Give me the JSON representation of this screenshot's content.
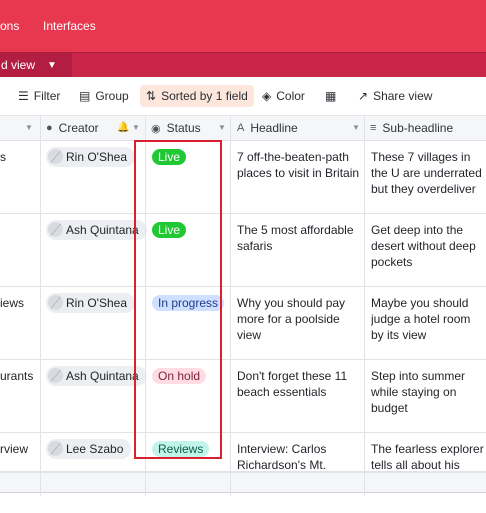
{
  "topbar": {
    "tabs": [
      "ons",
      "Interfaces"
    ],
    "view_name": "d view",
    "colors": {
      "top": "#e8384f",
      "sub": "#c9264a"
    }
  },
  "toolbar": {
    "filter": "Filter",
    "group": "Group",
    "sorted": "Sorted by 1 field",
    "color": "Color",
    "share": "Share view"
  },
  "columns": {
    "creator": "Creator",
    "status": "Status",
    "headline": "Headline",
    "subheadline": "Sub-headline"
  },
  "rows": [
    {
      "c0": "s",
      "creator": "Rin O'Shea",
      "status": "Live",
      "status_bg": "#20c933",
      "status_fg": "#ffffff",
      "headline": "7 off-the-beaten-path places to visit in Britain",
      "subhead": "These 7 villages in the U are underrated but they overdeliver"
    },
    {
      "c0": "",
      "creator": "Ash Quintana",
      "status": "Live",
      "status_bg": "#20c933",
      "status_fg": "#ffffff",
      "headline": "The 5 most affordable safaris",
      "subhead": "Get deep into the desert without deep pockets"
    },
    {
      "c0": "iews",
      "creator": "Rin O'Shea",
      "status": "In progress",
      "status_bg": "#cfdfff",
      "status_fg": "#1d3f8a",
      "headline": "Why you should pay more for a poolside view",
      "subhead": "Maybe you should judge a hotel room by its view"
    },
    {
      "c0": "urants",
      "creator": "Ash Quintana",
      "status": "On hold",
      "status_bg": "#ffdce5",
      "status_fg": "#7a1f33",
      "headline": "Don't forget these 11 beach essentials",
      "subhead": "Step into summer while staying on budget"
    },
    {
      "c0": "rview",
      "creator": "Lee Szabo",
      "status": "Reviews",
      "status_bg": "#c2f5e9",
      "status_fg": "#0b5c4a",
      "headline": "Interview: Carlos Richardson's Mt. Kilimanjaro adventure",
      "subhead": "The fearless explorer tells all about his volcanic cl"
    }
  ]
}
